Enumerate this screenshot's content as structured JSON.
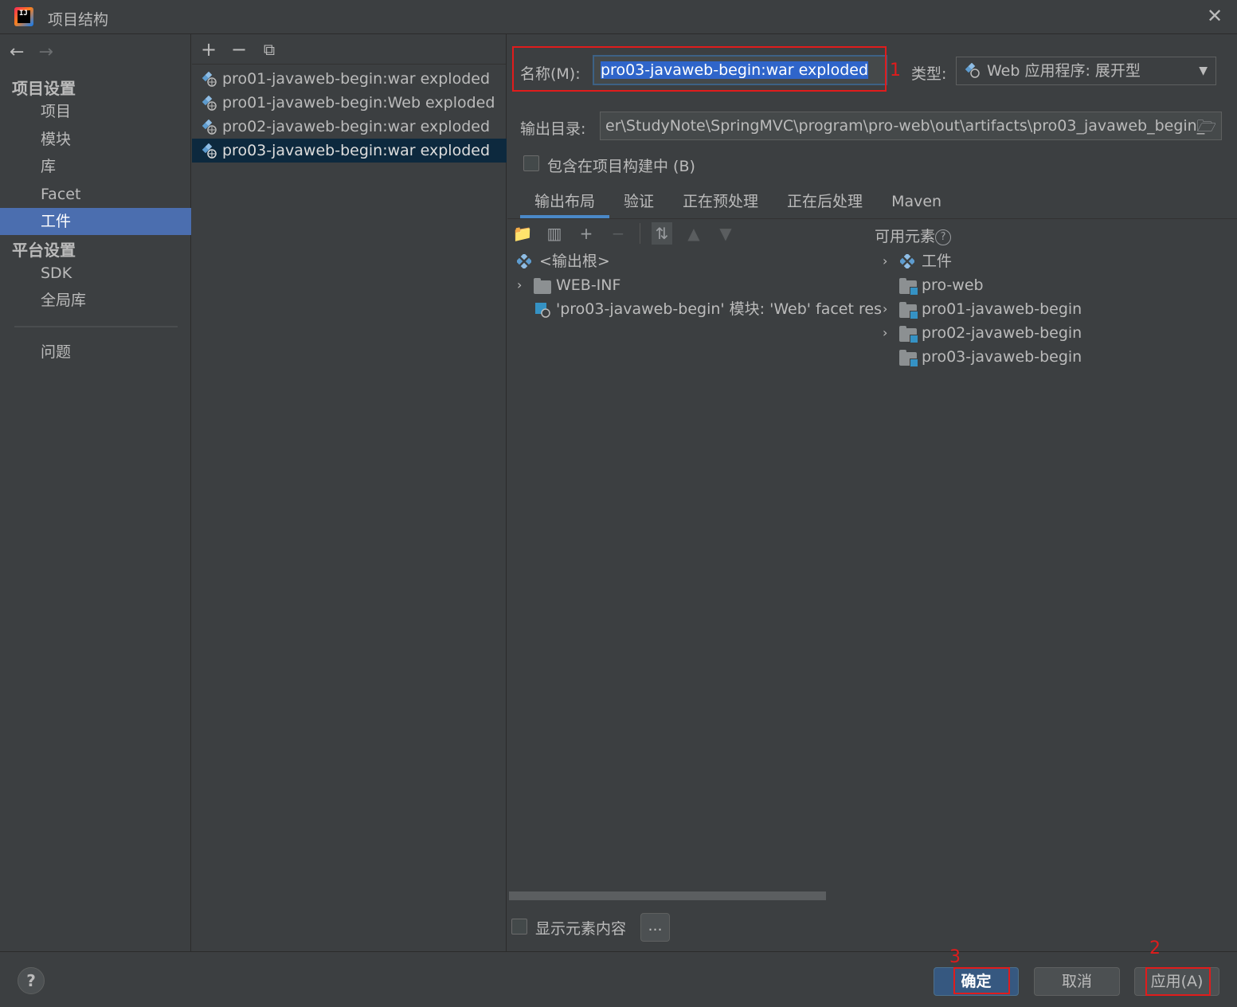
{
  "window": {
    "title": "项目结构",
    "logo_text": "IJ"
  },
  "nav": {
    "back_icon": "←",
    "forward_icon": "→",
    "project_settings_header": "项目设置",
    "project_settings_items": [
      "项目",
      "模块",
      "库",
      "Facet",
      "工件"
    ],
    "selected_item": "工件",
    "platform_settings_header": "平台设置",
    "platform_settings_items": [
      "SDK",
      "全局库"
    ],
    "problems": "问题"
  },
  "artifacts": {
    "toolbar": {
      "add": "+",
      "remove": "−",
      "copy": "⧉"
    },
    "items": [
      "pro01-javaweb-begin:war exploded",
      "pro01-javaweb-begin:Web exploded",
      "pro02-javaweb-begin:war exploded",
      "pro03-javaweb-begin:war exploded"
    ],
    "selected_index": 3
  },
  "form": {
    "name_label": "名称(M):",
    "name_value": "pro03-javaweb-begin:war exploded",
    "type_label": "类型:",
    "type_value": "Web 应用程序: 展开型",
    "output_label": "输出目录:",
    "output_value": "er\\StudyNote\\SpringMVC\\program\\pro-web\\out\\artifacts\\pro03_javaweb_begin_",
    "include_label": "包含在项目构建中 (B)",
    "include_checked": false
  },
  "tabs": [
    "输出布局",
    "验证",
    "正在预处理",
    "正在后处理",
    "Maven"
  ],
  "active_tab": "输出布局",
  "layout_tree": {
    "root": "<输出根>",
    "children": [
      {
        "label": "WEB-INF",
        "expandable": true
      },
      {
        "label": "'pro03-javaweb-begin' 模块: 'Web' facet res",
        "expandable": false
      }
    ]
  },
  "available": {
    "label": "可用元素",
    "help": "?",
    "items": [
      {
        "label": "工件",
        "expandable": true,
        "icon": "artifact-diamond-icon"
      },
      {
        "label": "pro-web",
        "expandable": false,
        "icon": "module-folder-icon"
      },
      {
        "label": "pro01-javaweb-begin",
        "expandable": true,
        "icon": "module-folder-icon"
      },
      {
        "label": "pro02-javaweb-begin",
        "expandable": true,
        "icon": "module-folder-icon"
      },
      {
        "label": "pro03-javaweb-begin",
        "expandable": false,
        "icon": "module-folder-icon"
      }
    ]
  },
  "bottom": {
    "show_content_label": "显示元素内容",
    "dots": "..."
  },
  "annotations": {
    "n1": "1",
    "n2": "2",
    "n3": "3"
  },
  "footer": {
    "help": "?",
    "ok": "确定",
    "cancel": "取消",
    "apply": "应用(A)"
  },
  "colors": {
    "background": "#3c3f41",
    "selection": "#4b6eaf",
    "list_selection": "#0d293e",
    "annotation_red": "#e01c1c",
    "primary_button": "#365880"
  }
}
